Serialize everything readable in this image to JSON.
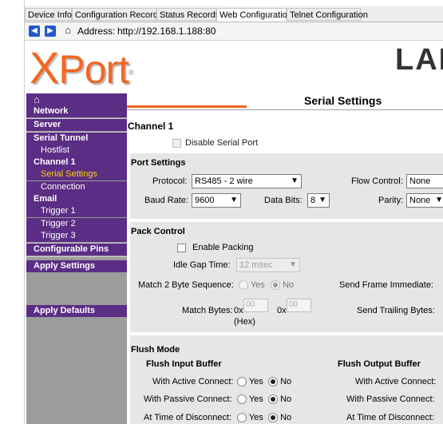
{
  "tabs": [
    {
      "label": "Device Info"
    },
    {
      "label": "Configuration Records"
    },
    {
      "label": "Status Records"
    },
    {
      "label": "Web Configuration"
    },
    {
      "label": "Telnet Configuration"
    }
  ],
  "address": {
    "label": "Address:",
    "url": "http://192.168.1.188:80"
  },
  "banner": {
    "logo_x": "X",
    "logo_rest": "Port",
    "logo_tm": "®",
    "brand": "LAN"
  },
  "sidebar": {
    "home_icon": "⌂",
    "items": {
      "network": "Network",
      "server": "Server",
      "serial_tunnel": "Serial Tunnel",
      "hostlist": "Hostlist",
      "channel1": "Channel 1",
      "serial_settings": "Serial Settings",
      "connection": "Connection",
      "email": "Email",
      "trigger1": "Trigger 1",
      "trigger2": "Trigger 2",
      "trigger3": "Trigger 3",
      "configurable_pins": "Configurable Pins",
      "apply_settings": "Apply Settings",
      "apply_defaults": "Apply Defaults"
    }
  },
  "page": {
    "title": "Serial Settings",
    "channel": "Channel 1",
    "disable_serial_port": "Disable Serial Port",
    "port_settings": {
      "heading": "Port Settings",
      "protocol_label": "Protocol:",
      "protocol_value": "RS485 - 2 wire",
      "flow_label": "Flow Control:",
      "flow_value": "None",
      "baud_label": "Baud Rate:",
      "baud_value": "9600",
      "databits_label": "Data Bits:",
      "databits_value": "8",
      "parity_label": "Parity:",
      "parity_value": "None"
    },
    "pack_control": {
      "heading": "Pack Control",
      "enable_packing": "Enable Packing",
      "idle_gap_label": "Idle Gap Time:",
      "idle_gap_value": "12 msec",
      "match2_label": "Match 2 Byte Sequence:",
      "yes": "Yes",
      "no": "No",
      "send_frame_label": "Send Frame Immediate:",
      "match_bytes_label": "Match Bytes:",
      "hex_prefix1": "0x",
      "hex_value1": "00",
      "hex_prefix2": "0x",
      "hex_value2": "00",
      "hex_note": "(Hex)",
      "send_trailing_label": "Send Trailing Bytes:"
    },
    "flush_mode": {
      "heading": "Flush Mode",
      "input_heading": "Flush Input Buffer",
      "output_heading": "Flush Output Buffer",
      "active_label": "With Active Connect:",
      "passive_label": "With Passive Connect:",
      "disconnect_label": "At Time of Disconnect:",
      "yes": "Yes",
      "no": "No"
    }
  }
}
